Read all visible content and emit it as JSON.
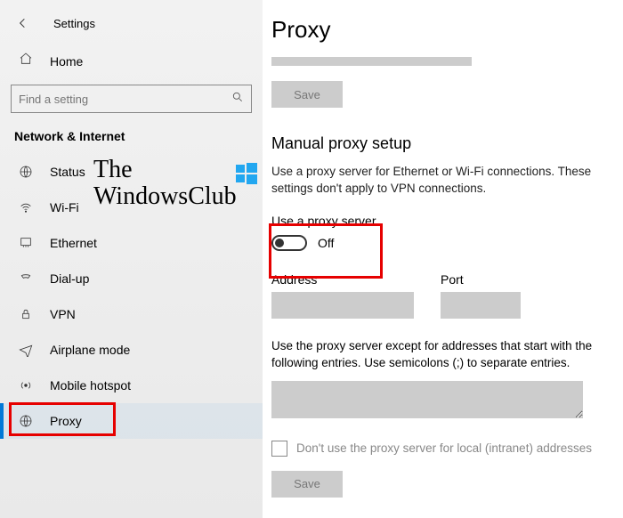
{
  "header": {
    "title": "Settings"
  },
  "home": {
    "label": "Home"
  },
  "search": {
    "placeholder": "Find a setting"
  },
  "category": "Network & Internet",
  "nav": {
    "items": [
      {
        "label": "Status"
      },
      {
        "label": "Wi-Fi"
      },
      {
        "label": "Ethernet"
      },
      {
        "label": "Dial-up"
      },
      {
        "label": "VPN"
      },
      {
        "label": "Airplane mode"
      },
      {
        "label": "Mobile hotspot"
      },
      {
        "label": "Proxy"
      }
    ]
  },
  "main": {
    "title": "Proxy",
    "save1": "Save",
    "section": "Manual proxy setup",
    "desc": "Use a proxy server for Ethernet or Wi-Fi connections. These settings don't apply to VPN connections.",
    "toggle_label": "Use a proxy server",
    "toggle_state": "Off",
    "address_label": "Address",
    "port_label": "Port",
    "exc_desc": "Use the proxy server except for addresses that start with the following entries. Use semicolons (;) to separate entries.",
    "check_label": "Don't use the proxy server for local (intranet) addresses",
    "save2": "Save"
  },
  "watermark": {
    "line1": "The",
    "line2": "WindowsClub"
  }
}
